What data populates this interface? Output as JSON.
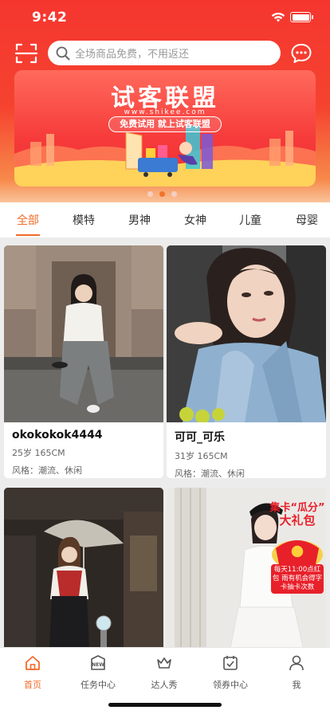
{
  "status_bar": {
    "time": "9:42"
  },
  "search": {
    "placeholder": "全场商品免费，不用返还"
  },
  "banner": {
    "title": "试客联盟",
    "url": "www.shikee.com",
    "slogan": "免费试用 就上试客联盟"
  },
  "carousel": {
    "count": 3,
    "active_index": 1
  },
  "tabs": [
    {
      "label": "全部",
      "active": true
    },
    {
      "label": "模特",
      "active": false
    },
    {
      "label": "男神",
      "active": false
    },
    {
      "label": "女神",
      "active": false
    },
    {
      "label": "儿童",
      "active": false
    },
    {
      "label": "母婴",
      "active": false
    }
  ],
  "cards": [
    {
      "name": "okokokok4444",
      "stats": "25岁  165CM",
      "style": "风格：潮流、休闲"
    },
    {
      "name": "可可_可乐",
      "stats": "31岁  165CM",
      "style": "风格：潮流、休闲"
    },
    {
      "name": "",
      "stats": "",
      "style": ""
    },
    {
      "name": "",
      "stats": "",
      "style": ""
    }
  ],
  "promo": {
    "line1": "集卡“瓜分”",
    "line2": "大礼包",
    "desc": "每天11:00点红包 雨有机会得字卡抽卡次数"
  },
  "bottom_nav": [
    {
      "label": "首页",
      "icon": "home-icon",
      "active": true
    },
    {
      "label": "任务中心",
      "icon": "new-task-icon",
      "active": false
    },
    {
      "label": "达人秀",
      "icon": "crown-icon",
      "active": false
    },
    {
      "label": "领券中心",
      "icon": "coupon-icon",
      "active": false
    },
    {
      "label": "我",
      "icon": "user-icon",
      "active": false
    }
  ],
  "colors": {
    "accent": "#f26b2a",
    "header": "#f5362f"
  }
}
